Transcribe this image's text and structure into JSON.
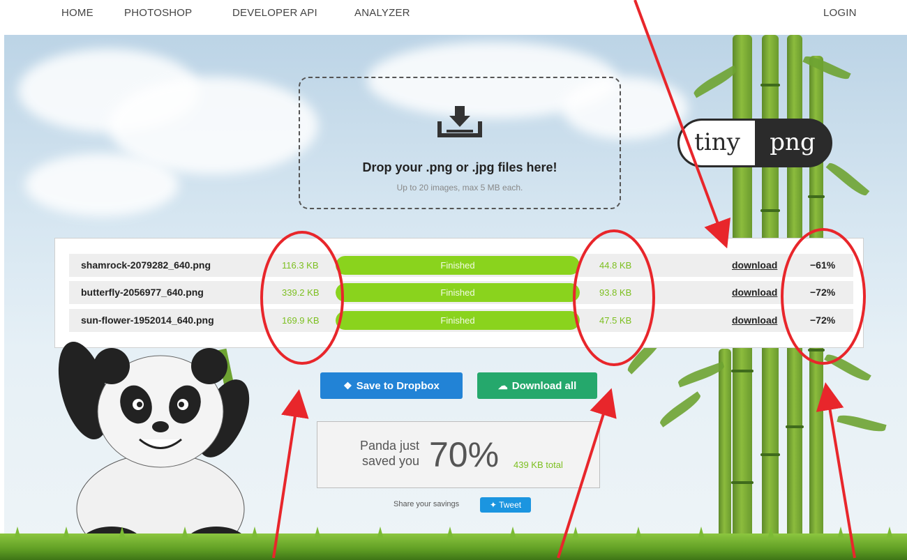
{
  "nav": {
    "home": "HOME",
    "photoshop": "PHOTOSHOP",
    "developer_api": "DEVELOPER API",
    "analyzer": "ANALYZER",
    "login": "LOGIN"
  },
  "dropzone": {
    "title": "Drop your .png or .jpg files here!",
    "subtitle": "Up to 20 images, max 5 MB each.",
    "icon": "download-tray-icon"
  },
  "logo": {
    "left": "tiny",
    "right": "png"
  },
  "files": [
    {
      "name": "shamrock-2079282_640.png",
      "original_size": "116.3 KB",
      "status": "Finished",
      "progress": 1.0,
      "new_size": "44.8 KB",
      "download_label": "download",
      "saving": "−61%"
    },
    {
      "name": "butterfly-2056977_640.png",
      "original_size": "339.2 KB",
      "status": "Finished",
      "progress": 1.0,
      "new_size": "93.8 KB",
      "download_label": "download",
      "saving": "−72%"
    },
    {
      "name": "sun-flower-1952014_640.png",
      "original_size": "169.9 KB",
      "status": "Finished",
      "progress": 1.0,
      "new_size": "47.5 KB",
      "download_label": "download",
      "saving": "−72%"
    }
  ],
  "actions": {
    "dropbox_label": "Save to Dropbox",
    "download_all_label": "Download all"
  },
  "savings": {
    "line1": "Panda just",
    "line2": "saved you",
    "percent": "70%",
    "total": "439 KB total"
  },
  "share": {
    "label": "Share your savings",
    "tweet_label": "Tweet"
  },
  "colors": {
    "accent_green": "#8ad31d",
    "size_text_green": "#7cbf1f",
    "dropbox_blue": "#2283d6",
    "download_green": "#25a86c",
    "tweet_blue": "#1b95e0",
    "annotation_red": "#e8262b"
  }
}
